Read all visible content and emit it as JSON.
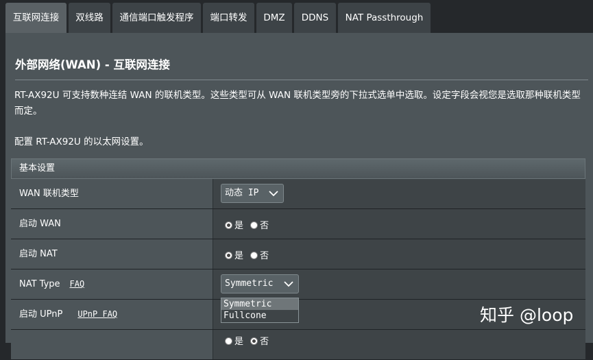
{
  "tabs": [
    "互联网连接",
    "双线路",
    "通信端口触发程序",
    "端口转发",
    "DMZ",
    "DDNS",
    "NAT Passthrough"
  ],
  "title": "外部网络(WAN) - 互联网连接",
  "description": "RT-AX92U 可支持数种连结 WAN 的联机类型。这些类型可从 WAN 联机类型旁的下拉式选单中选取。设定字段会视您是选取那种联机类型而定。",
  "config_text": "配置 RT-AX92U 的以太网设置。",
  "section_header": "基本设置",
  "rows": {
    "wan_type": {
      "label": "WAN 联机类型",
      "value": "动态 IP"
    },
    "enable_wan": {
      "label": "启动 WAN",
      "yes": "是",
      "no": "否",
      "selected": "yes"
    },
    "enable_nat": {
      "label": "启动 NAT",
      "yes": "是",
      "no": "否",
      "selected": "yes"
    },
    "nat_type": {
      "label": "NAT Type",
      "faq": "FAQ",
      "value": "Symmetric"
    },
    "enable_upnp": {
      "label": "启动 UPnP",
      "faq": "UPnP FAQ"
    },
    "partial": {
      "yes": "是",
      "no": "否",
      "selected": "no"
    }
  },
  "nat_dropdown": {
    "options": [
      "Symmetric",
      "Fullcone"
    ],
    "highlighted": "Symmetric"
  },
  "watermark": "知乎 @loop",
  "colors": {
    "background": "#25282b",
    "panel": "#4d5559",
    "tab": "#3d4347",
    "tab_active": "#5a6165"
  }
}
